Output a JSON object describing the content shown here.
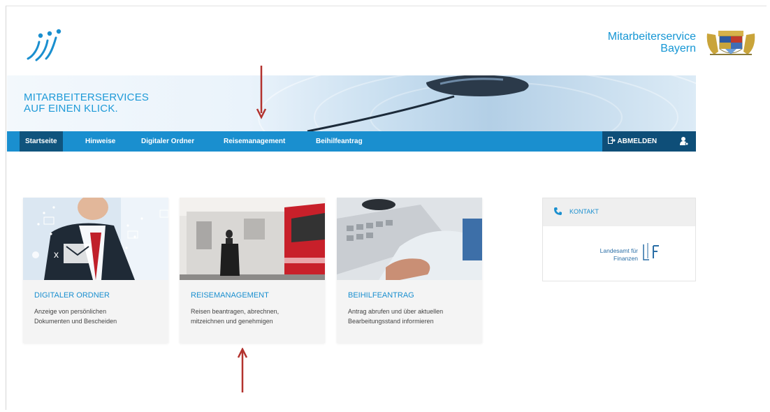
{
  "header": {
    "brand_line1": "Mitarbeiterservice",
    "brand_line2": "Bayern"
  },
  "banner": {
    "line1": "MITARBEITERSERVICES",
    "line2": "AUF EINEN KLICK."
  },
  "nav": {
    "items": [
      {
        "label": "Startseite",
        "active": true
      },
      {
        "label": "Hinweise",
        "active": false
      },
      {
        "label": "Digitaler Ordner",
        "active": false
      },
      {
        "label": "Reisemanagement",
        "active": false
      },
      {
        "label": "Beihilfeantrag",
        "active": false
      }
    ],
    "logout_label": "ABMELDEN"
  },
  "tiles": [
    {
      "title": "DIGITALER ORDNER",
      "desc_line1": "Anzeige von persönlichen",
      "desc_line2": "Dokumenten und Bescheiden"
    },
    {
      "title": "REISEMANAGEMENT",
      "desc_line1": "Reisen beantragen, abrechnen,",
      "desc_line2": "mitzeichnen und genehmigen"
    },
    {
      "title": "BEIHILFEANTRAG",
      "desc_line1": "Antrag abrufen und über aktuellen",
      "desc_line2": "Bearbeitungsstand informieren"
    }
  ],
  "contact": {
    "label": "KONTAKT",
    "org_line1": "Landesamt für",
    "org_line2": "Finanzen"
  },
  "colors": {
    "accent": "#1a8fcf",
    "nav_active": "#10547d",
    "annotation_arrow": "#b3322e"
  },
  "icons": [
    "logo-icon",
    "crest-icon",
    "logout-icon",
    "user-icon",
    "phone-icon"
  ]
}
